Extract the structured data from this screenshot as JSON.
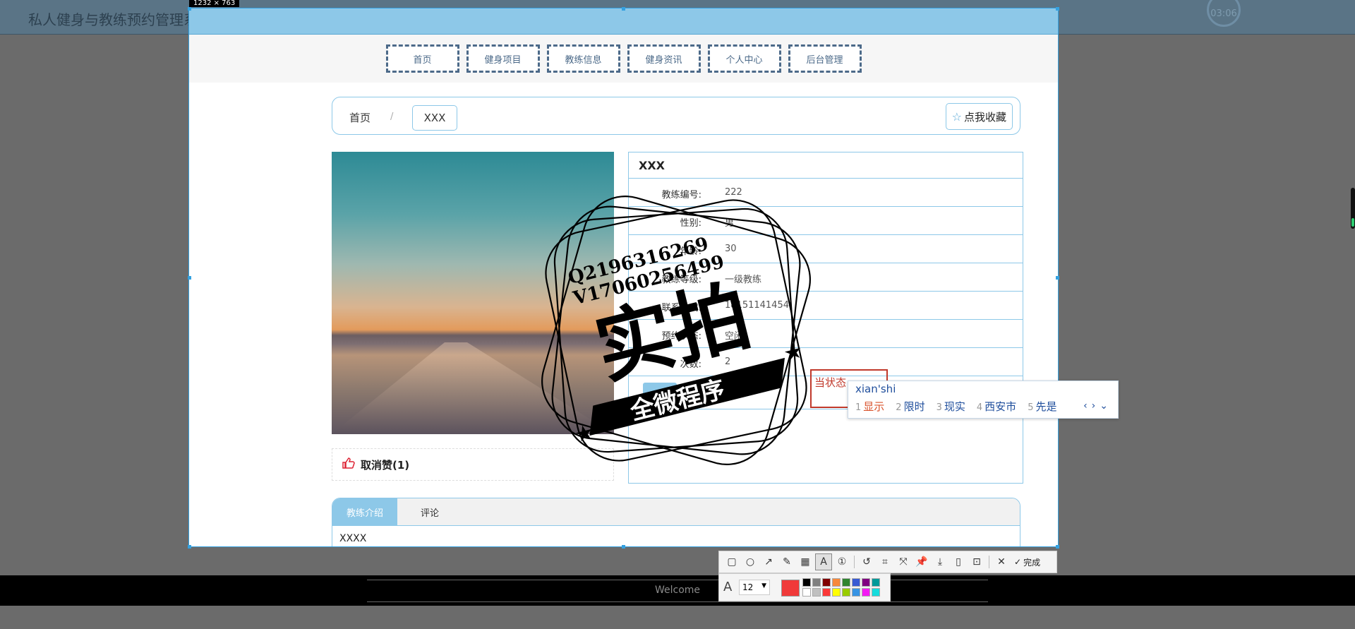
{
  "app": {
    "title": "私人健身与教练预约管理系统",
    "clock": "03:06"
  },
  "capture": {
    "size_label": "1232 × 763"
  },
  "nav": {
    "items": [
      "首页",
      "健身项目",
      "教练信息",
      "健身资讯",
      "个人中心",
      "后台管理"
    ]
  },
  "breadcrumb": {
    "home": "首页",
    "separator": "/",
    "current": "XXX",
    "favorite_label": "点我收藏"
  },
  "like": {
    "label": "取消赞(1)"
  },
  "info": {
    "title": "XXX",
    "rows": [
      {
        "label": "教练编号:",
        "value": "222"
      },
      {
        "label": "性别:",
        "value": "男"
      },
      {
        "label": "年龄:",
        "value": "30"
      },
      {
        "label": "教练等级:",
        "value": "一级教练"
      },
      {
        "label": "联系方式:",
        "value": "18151141454"
      },
      {
        "label": "预约状态:",
        "value": "空闲"
      },
      {
        "label": "次数:",
        "value": "2"
      }
    ],
    "status_text": "当状态"
  },
  "tabs": {
    "items": [
      "教练介绍",
      "评论"
    ],
    "active": 0,
    "content": "XXXX"
  },
  "watermark": {
    "line1": "Q2196316269",
    "line2": "V17060256499",
    "main": "实拍",
    "banner": "全微程序"
  },
  "ime": {
    "input": "xian'shi",
    "candidates": [
      {
        "n": "1",
        "text": "显示"
      },
      {
        "n": "2",
        "text": "限时"
      },
      {
        "n": "3",
        "text": "现实"
      },
      {
        "n": "4",
        "text": "西安市"
      },
      {
        "n": "5",
        "text": "先是"
      }
    ]
  },
  "toolbar": {
    "done_label": "完成",
    "font_size": "12",
    "current_color": "#f03a3a",
    "swatches": [
      "#000000",
      "#808080",
      "#800000",
      "#f7883a",
      "#308430",
      "#385ad3",
      "#800080",
      "#009999",
      "#ffffff",
      "#c0c0c0",
      "#fb3838",
      "#ffff00",
      "#99cc00",
      "#3894e4",
      "#f31bf3",
      "#16dcdc"
    ]
  },
  "footer": {
    "text": "Welcome"
  }
}
